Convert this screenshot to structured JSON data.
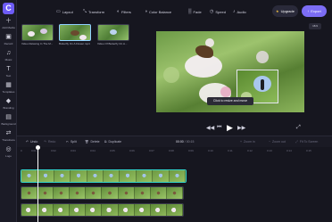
{
  "app": {
    "logo_letter": "C"
  },
  "sidebar": {
    "items": [
      {
        "label": "Add Media",
        "icon": "plus-icon"
      },
      {
        "label": "Record",
        "icon": "camera-icon"
      },
      {
        "label": "Music",
        "icon": "music-icon"
      },
      {
        "label": "Text",
        "icon": "text-icon"
      },
      {
        "label": "Templates",
        "icon": "grid-icon"
      },
      {
        "label": "Branding",
        "icon": "brand-icon"
      },
      {
        "label": "Background",
        "icon": "background-icon"
      },
      {
        "label": "Transitions",
        "icon": "transition-icon"
      },
      {
        "label": "Logo",
        "icon": "logo-icon"
      }
    ]
  },
  "toolbar": {
    "layout": "Layout",
    "transform": "Transform",
    "filters": "Filters",
    "color_balance": "Color Balance",
    "fade": "Fade",
    "speed": "Speed",
    "audio": "Audio",
    "upgrade": "Upgrade",
    "export": "Export"
  },
  "media": [
    {
      "caption": "Video Relaxing In The M..."
    },
    {
      "caption": "Butterfly On A Flower.mp4"
    },
    {
      "caption": "Video Of Butterfly On A..."
    }
  ],
  "preview": {
    "aspect_ratio": "16:9",
    "tooltip": "Click to resize and move"
  },
  "playback": {
    "rewind": "⏮",
    "back": "◀◀",
    "play": "▶",
    "forward": "▶▶",
    "fullscreen": "⤢"
  },
  "timeline": {
    "undo": "Undo",
    "redo": "Redo",
    "split": "Split",
    "delete": "Delete",
    "duplicate": "Duplicate",
    "time_current": "00:00",
    "time_total": "/ 00:15",
    "zoom_in": "Zoom in",
    "zoom_out": "Zoom out",
    "fit": "Fit To Screen",
    "ruler": [
      "0",
      "0:01",
      "0:02",
      "0:03",
      "0:04",
      "0:05",
      "0:06",
      "0:07",
      "0:08",
      "0:09",
      "0:10",
      "0:11",
      "0:12",
      "0:13",
      "0:14",
      "0:15"
    ]
  },
  "colors": {
    "accent": "#7c6df5",
    "selected_track": "#32d3c9"
  }
}
